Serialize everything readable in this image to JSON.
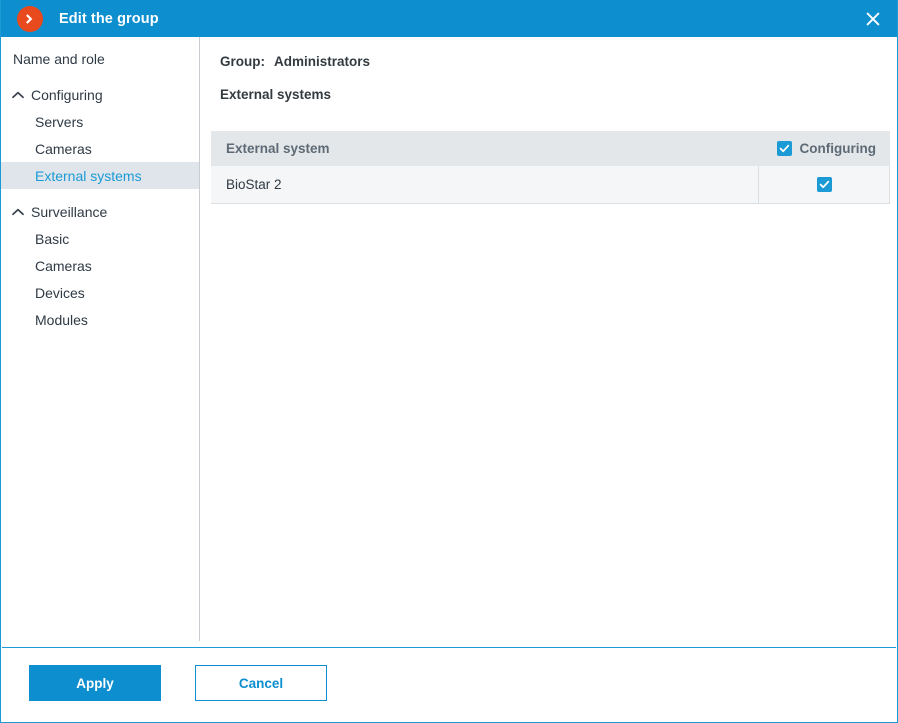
{
  "window": {
    "title": "Edit the group",
    "app_icon": "chevron-right-circle-icon",
    "close_icon": "close-icon",
    "accent_color": "#0d8ecf",
    "icon_color": "#e8491d"
  },
  "sidebar": {
    "items": [
      {
        "label": "Name and role",
        "level": "root",
        "chevron": null,
        "selected": false
      },
      {
        "label": "Configuring",
        "level": "group",
        "chevron": "chevron-up-icon",
        "selected": false
      },
      {
        "label": "Servers",
        "level": "child",
        "chevron": null,
        "selected": false
      },
      {
        "label": "Cameras",
        "level": "child",
        "chevron": null,
        "selected": false
      },
      {
        "label": "External systems",
        "level": "child",
        "chevron": null,
        "selected": true
      },
      {
        "label": "Surveillance",
        "level": "group",
        "chevron": "chevron-up-icon",
        "selected": false
      },
      {
        "label": "Basic",
        "level": "child",
        "chevron": null,
        "selected": false
      },
      {
        "label": "Cameras",
        "level": "child",
        "chevron": null,
        "selected": false
      },
      {
        "label": "Devices",
        "level": "child",
        "chevron": null,
        "selected": false
      },
      {
        "label": "Modules",
        "level": "child",
        "chevron": null,
        "selected": false
      }
    ]
  },
  "main": {
    "group_label": "Group:",
    "group_name": "Administrators",
    "section_title": "External systems",
    "table": {
      "columns": [
        {
          "key": "name",
          "label": "External system"
        },
        {
          "key": "configuring",
          "label": "Configuring",
          "header_checkbox": true,
          "header_checked": true
        }
      ],
      "rows": [
        {
          "name": "BioStar 2",
          "configuring": true
        }
      ]
    }
  },
  "footer": {
    "apply_label": "Apply",
    "cancel_label": "Cancel"
  }
}
